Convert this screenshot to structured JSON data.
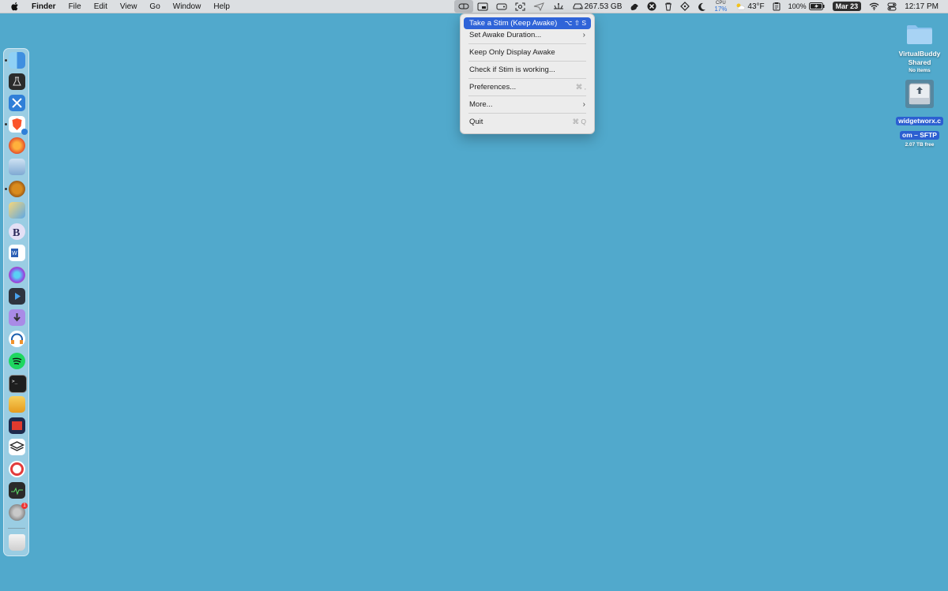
{
  "menubar": {
    "app_name": "Finder",
    "menus": [
      "File",
      "Edit",
      "View",
      "Go",
      "Window",
      "Help"
    ],
    "disk_free": "267.53 GB",
    "cpu_label": "CPU",
    "cpu_percent": "17%",
    "weather": "43°F",
    "battery": "100%",
    "date": "Mar 23",
    "time": "12:17 PM"
  },
  "dropdown": {
    "items": [
      {
        "label": "Take a Stim (Keep Awake)",
        "shortcut": "⌥ ⇧ S"
      },
      {
        "label": "Set Awake Duration..."
      },
      {
        "label": "Keep Only Display Awake"
      },
      {
        "label": "Check if Stim is working..."
      },
      {
        "label": "Preferences...",
        "shortcut": "⌘ ,"
      },
      {
        "label": "More..."
      },
      {
        "label": "Quit",
        "shortcut": "⌘ Q"
      }
    ]
  },
  "desktop": {
    "virtualbuddy": {
      "name_line1": "VirtualBuddy",
      "name_line2": "Shared",
      "sub": "No items"
    },
    "sftp": {
      "name_line1": "widgetworx.c",
      "name_line2": "om – SFTP",
      "sub": "2.07 TB free"
    }
  },
  "dock": {
    "settings_badge": "1"
  },
  "colors": {
    "desktop": "#51a9cc",
    "highlight": "#2f64d8"
  }
}
